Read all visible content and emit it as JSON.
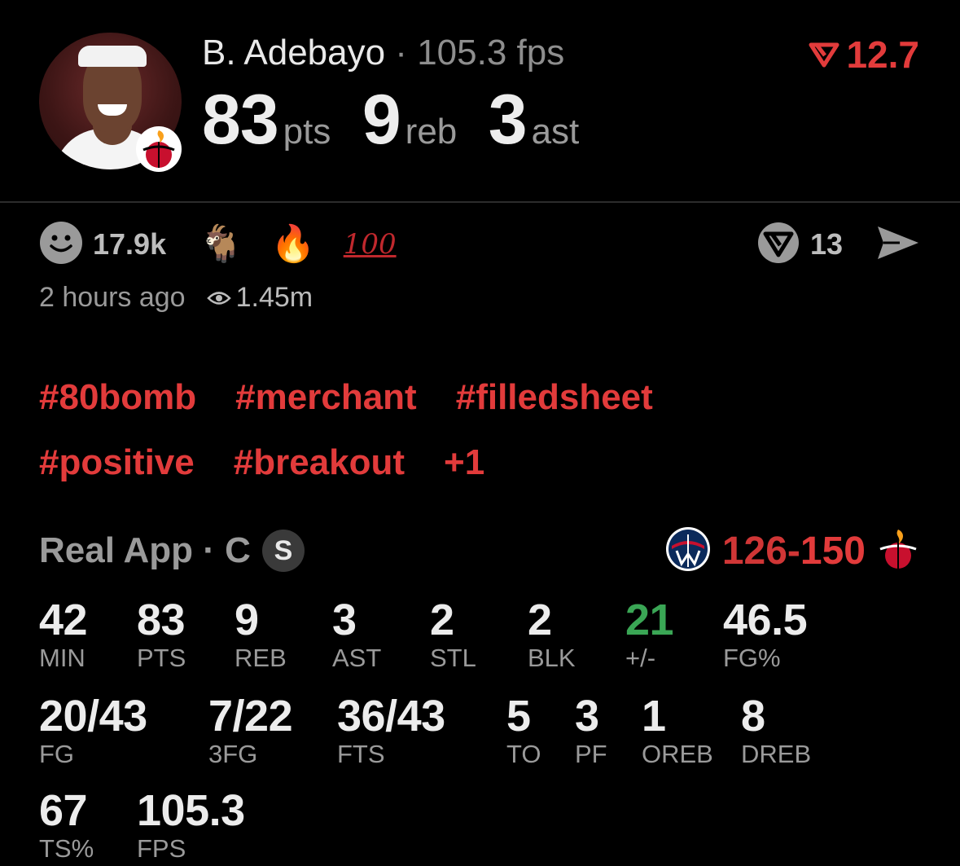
{
  "header": {
    "player_name": "B. Adebayo",
    "separator": " · ",
    "fps_label": "105.3 fps",
    "delta_value": "12.7",
    "big_stats": [
      {
        "value": "83",
        "unit": "pts"
      },
      {
        "value": "9",
        "unit": "reb"
      },
      {
        "value": "3",
        "unit": "ast"
      }
    ]
  },
  "reactions": {
    "emoji_reaction_count": "17.9k",
    "emojis": [
      "🐐",
      "🔥"
    ],
    "hundred": "100",
    "share_count": "13"
  },
  "meta": {
    "time_ago": "2 hours ago",
    "views": "1.45m"
  },
  "tags": {
    "row1": [
      "#80bomb",
      "#merchant",
      "#filledsheet"
    ],
    "row2": [
      "#positive",
      "#breakout",
      "+1"
    ]
  },
  "league": {
    "label": "Real App · C",
    "badge": "S",
    "score_away": "126",
    "score_dash": "-",
    "score_home": "150"
  },
  "stats": [
    {
      "value": "42",
      "label": "MIN"
    },
    {
      "value": "83",
      "label": "PTS"
    },
    {
      "value": "9",
      "label": "REB"
    },
    {
      "value": "3",
      "label": "AST"
    },
    {
      "value": "2",
      "label": "STL"
    },
    {
      "value": "2",
      "label": "BLK"
    },
    {
      "value": "21",
      "label": "+/-"
    },
    {
      "value": "46.5",
      "label": "FG%"
    },
    {
      "value": "20/43",
      "label": "FG"
    },
    {
      "value": "7/22",
      "label": "3FG"
    },
    {
      "value": "36/43",
      "label": "FTS"
    },
    {
      "value": "5",
      "label": "TO"
    },
    {
      "value": "3",
      "label": "PF"
    },
    {
      "value": "1",
      "label": "OREB"
    },
    {
      "value": "8",
      "label": "DREB"
    },
    {
      "value": "67",
      "label": "TS%"
    },
    {
      "value": "105.3",
      "label": "FPS"
    }
  ],
  "colors": {
    "accent_red": "#e23b3b",
    "positive_green": "#3aa655",
    "muted_gray": "#9a9a9a",
    "background": "#000000"
  }
}
